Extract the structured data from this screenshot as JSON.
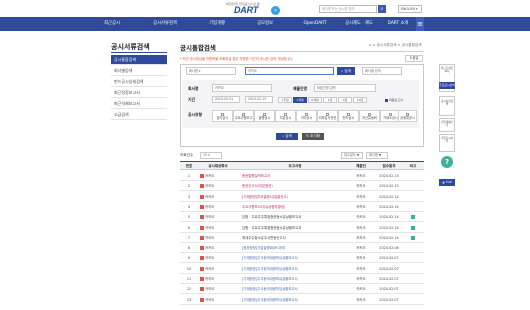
{
  "header": {
    "logo_sub": "대한민국 전자공시시스템",
    "logo_text": "DART",
    "search_placeholder": "회사명 또는 공시명 입력",
    "language": "ENGLISH"
  },
  "gnb": [
    "최근공시",
    "공시서류검색",
    "기업개황",
    "공모정보",
    "OpenDART",
    "공시제도 · 제도",
    "DART 소개"
  ],
  "lnb": {
    "title": "공시서류검색",
    "items": [
      "공시통합검색",
      "회사별검색",
      "펀드공시상세검색",
      "최근정정보고서",
      "최근삭제보고서",
      "고급검색"
    ]
  },
  "page": {
    "title": "공시통합검색",
    "breadcrumb": "⌂ > 공시서류검색 > 공시통합검색",
    "notice": "* 최근 공시대상을 전종목을 조회하실 경우 지정한 기간의 공시만 검색 가능합니다.",
    "help": "도움말"
  },
  "search": {
    "scope": "회사명",
    "query": "카카오",
    "search_button": "검색",
    "detail_placeholder": "회사별 검색"
  },
  "filters": {
    "company_label": "회사명",
    "company_value": "카카오",
    "report_label": "제출인명",
    "report_placeholder": "제출인명 입력",
    "period_label": "기간",
    "date_from": "2024.02.01",
    "date_to": "2024.02.15",
    "period_buttons": [
      "1주일",
      "1개월",
      "6개월",
      "1년",
      "3년",
      "10년"
    ],
    "final_report_label": "최종보고서",
    "type_label": "공시유형",
    "types": [
      "정기공시",
      "주요사항보고",
      "발행공시",
      "지분공시",
      "기타공시",
      "외부감사관련",
      "펀드공시",
      "자산유동화",
      "거래소공시",
      "공정위공시"
    ],
    "search_button": "검색",
    "reset_button": "초기화"
  },
  "results": {
    "total_label": "조회건수",
    "page_size": "15",
    "sort_label": "접수일자 ▼",
    "sort_label2": "회사명 ▼",
    "columns": [
      "번호",
      "공시대상회사",
      "보고서명",
      "제출인",
      "접수일자",
      "비고"
    ],
    "rows": [
      {
        "no": "1",
        "company": "카카오",
        "report": "증권발행실적보고서",
        "style": "pink",
        "submitter": "카카오",
        "date": "2024.02.15",
        "rem": false
      },
      {
        "no": "2",
        "company": "카카오",
        "report": "증권신고서(지분증권)",
        "style": "pink",
        "submitter": "카카오",
        "date": "2024.02.15",
        "rem": false
      },
      {
        "no": "3",
        "company": "카카오",
        "report": "[기재정정]투자설명서(일괄신고)",
        "style": "pink",
        "submitter": "카카오",
        "date": "2024.02.14",
        "rem": false
      },
      {
        "no": "4",
        "company": "카카오",
        "report": "주요사항보고서(유상증자결정)",
        "style": "pink",
        "submitter": "카카오",
        "date": "2024.02.14",
        "rem": false
      },
      {
        "no": "5",
        "company": "카카오",
        "report": "임원 · 주요주주특정증권등소유상황보고서",
        "style": "dark",
        "submitter": "카카오",
        "date": "2024.02.14",
        "rem": true
      },
      {
        "no": "6",
        "company": "카카오",
        "report": "임원 · 주요주주특정증권등소유상황보고서",
        "style": "dark",
        "submitter": "카카오",
        "date": "2024.02.14",
        "rem": true
      },
      {
        "no": "7",
        "company": "카카오",
        "report": "최대주주등소유주식변동신고서",
        "style": "dark",
        "submitter": "카카오",
        "date": "2024.02.14",
        "rem": true
      },
      {
        "no": "8",
        "company": "카카오",
        "report": "[첨부정정]기업설명회(IR)개최",
        "style": "blue",
        "submitter": "카카오",
        "date": "2024.02.08",
        "rem": false
      },
      {
        "no": "9",
        "company": "카카오",
        "report": "[기재정정]주식등의대량보유상황보고서",
        "style": "blue",
        "submitter": "카카오",
        "date": "2024.02.07",
        "rem": false
      },
      {
        "no": "10",
        "company": "카카오",
        "report": "[기재정정]주식등의대량보유상황보고서",
        "style": "blue",
        "submitter": "카카오",
        "date": "2024.02.07",
        "rem": false
      },
      {
        "no": "11",
        "company": "카카오",
        "report": "[기재정정]주식등의대량보유상황보고서",
        "style": "blue",
        "submitter": "카카오",
        "date": "2024.02.07",
        "rem": false
      },
      {
        "no": "12",
        "company": "카카오",
        "report": "[기재정정]주식등의대량보유상황보고서",
        "style": "blue",
        "submitter": "카카오",
        "date": "2024.02.07",
        "rem": false
      },
      {
        "no": "13",
        "company": "카카오",
        "report": "[기재정정]주식등의대량보유상황보고서",
        "style": "blue",
        "submitter": "카카오",
        "date": "2024.02.07",
        "rem": false
      }
    ]
  },
  "side": {
    "recent": "최근조회한 회사",
    "box1": "주요공시검색",
    "box2": "공시통합검색",
    "box3": "기업개황보기",
    "box4": "기업공시서식",
    "help_glyph": "?",
    "top": "TOP"
  }
}
